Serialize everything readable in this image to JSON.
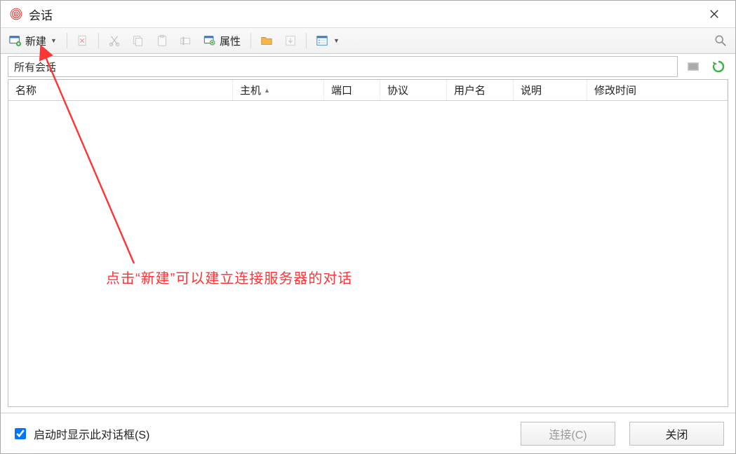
{
  "window": {
    "title": "会话"
  },
  "toolbar": {
    "new_label": "新建",
    "properties_label": "属性"
  },
  "path": {
    "current": "所有会话"
  },
  "table": {
    "columns": {
      "name": "名称",
      "host": "主机",
      "port": "端口",
      "protocol": "协议",
      "user": "用户名",
      "description": "说明",
      "modified": "修改时间"
    },
    "rows": []
  },
  "footer": {
    "show_on_startup_label": "启动时显示此对话框(S)",
    "show_on_startup_checked": true,
    "connect_label": "连接(C)",
    "close_label": "关闭"
  },
  "annotation": {
    "text": "点击“新建”可以建立连接服务器的对话",
    "target": "new-button"
  }
}
